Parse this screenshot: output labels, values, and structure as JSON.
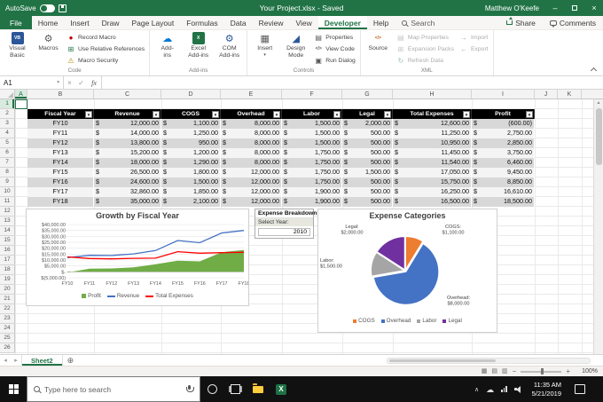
{
  "titlebar": {
    "autosave_label": "AutoSave",
    "title": "Your Project.xlsx - Saved",
    "user": "Matthew O'Keefe"
  },
  "ribbon": {
    "tabs": [
      {
        "label": "File",
        "variant": "file"
      },
      {
        "label": "Home"
      },
      {
        "label": "Insert"
      },
      {
        "label": "Draw"
      },
      {
        "label": "Page Layout"
      },
      {
        "label": "Formulas"
      },
      {
        "label": "Data"
      },
      {
        "label": "Review"
      },
      {
        "label": "View"
      },
      {
        "label": "Developer",
        "active": true
      },
      {
        "label": "Help"
      }
    ],
    "search_label": "Search",
    "share_label": "Share",
    "comments_label": "Comments",
    "groups": [
      {
        "label": "Code",
        "buttons": [
          {
            "label": "Visual Basic",
            "lines": [
              "Visual",
              "Basic"
            ],
            "size": "big",
            "icon": "visual-basic"
          },
          {
            "label": "Macros",
            "size": "big",
            "icon": "macros"
          },
          {
            "label": "Record Macro",
            "size": "small",
            "icon": "record-macro"
          },
          {
            "label": "Use Relative References",
            "size": "small",
            "icon": "relative-references"
          },
          {
            "label": "Macro Security",
            "size": "small",
            "icon": "macro-security"
          }
        ]
      },
      {
        "label": "Add-ins",
        "buttons": [
          {
            "label": "Add-ins",
            "lines": [
              "Add-",
              "ins"
            ],
            "size": "big",
            "icon": "office-add-ins"
          },
          {
            "label": "Excel Add-ins",
            "lines": [
              "Excel",
              "Add-ins"
            ],
            "size": "big",
            "icon": "excel-add-ins"
          },
          {
            "label": "COM Add-ins",
            "lines": [
              "COM",
              "Add-ins"
            ],
            "size": "big",
            "icon": "com-add-ins"
          }
        ]
      },
      {
        "label": "Controls",
        "buttons": [
          {
            "label": "Insert",
            "size": "big",
            "icon": "insert-control",
            "caret": true
          },
          {
            "label": "Design Mode",
            "lines": [
              "Design",
              "Mode"
            ],
            "size": "big",
            "icon": "design-mode"
          },
          {
            "label": "Properties",
            "size": "small",
            "icon": "properties"
          },
          {
            "label": "View Code",
            "size": "small",
            "icon": "view-code"
          },
          {
            "label": "Run Dialog",
            "size": "small",
            "icon": "run-dialog"
          }
        ]
      },
      {
        "label": "XML",
        "buttons": [
          {
            "label": "Source",
            "size": "big",
            "icon": "xml-source"
          },
          {
            "label": "Map Properties",
            "size": "small",
            "icon": "map-properties",
            "disabled": true
          },
          {
            "label": "Expansion Packs",
            "size": "small",
            "icon": "expansion-packs",
            "disabled": true
          },
          {
            "label": "Refresh Data",
            "size": "small",
            "icon": "refresh-data",
            "disabled": true
          },
          {
            "label": "Import",
            "size": "small",
            "icon": "import",
            "disabled": true
          },
          {
            "label": "Export",
            "size": "small",
            "icon": "export",
            "disabled": true
          }
        ]
      }
    ]
  },
  "formula_bar": {
    "name_box": "A1",
    "formula": ""
  },
  "sheet": {
    "columns": [
      "A",
      "B",
      "C",
      "D",
      "E",
      "F",
      "G",
      "H",
      "I",
      "J",
      "K"
    ],
    "rows_visible": 26,
    "selected_cell": "A1",
    "table": {
      "currency": "$",
      "headers": [
        "Fiscal Year",
        "Revenue",
        "COGS",
        "Overhead",
        "Labor",
        "Legal",
        "Total Expenses",
        "Profit"
      ],
      "rows": [
        {
          "year": "FY10",
          "values": [
            "12,000.00",
            "1,100.00",
            "8,000.00",
            "1,500.00",
            "2,000.00",
            "12,600.00",
            "(600.00)"
          ]
        },
        {
          "year": "FY11",
          "values": [
            "14,000.00",
            "1,250.00",
            "8,000.00",
            "1,500.00",
            "500.00",
            "11,250.00",
            "2,750.00"
          ]
        },
        {
          "year": "FY12",
          "values": [
            "13,800.00",
            "950.00",
            "8,000.00",
            "1,500.00",
            "500.00",
            "10,950.00",
            "2,850.00"
          ]
        },
        {
          "year": "FY13",
          "values": [
            "15,200.00",
            "1,200.00",
            "8,000.00",
            "1,750.00",
            "500.00",
            "11,450.00",
            "3,750.00"
          ]
        },
        {
          "year": "FY14",
          "values": [
            "18,000.00",
            "1,290.00",
            "8,000.00",
            "1,750.00",
            "500.00",
            "11,540.00",
            "6,460.00"
          ]
        },
        {
          "year": "FY15",
          "values": [
            "26,500.00",
            "1,800.00",
            "12,000.00",
            "1,750.00",
            "1,500.00",
            "17,050.00",
            "9,450.00"
          ]
        },
        {
          "year": "FY16",
          "values": [
            "24,600.00",
            "1,500.00",
            "12,000.00",
            "1,750.00",
            "500.00",
            "15,750.00",
            "8,850.00"
          ]
        },
        {
          "year": "FY17",
          "values": [
            "32,860.00",
            "1,850.00",
            "12,000.00",
            "1,900.00",
            "500.00",
            "16,250.00",
            "16,610.00"
          ]
        },
        {
          "year": "FY18",
          "values": [
            "35,000.00",
            "2,100.00",
            "12,000.00",
            "1,900.00",
            "500.00",
            "16,500.00",
            "18,500.00"
          ]
        }
      ]
    }
  },
  "slicer": {
    "title": "Expense Breakdown",
    "field_label": "Select Year:",
    "selected": "2010"
  },
  "chart_data": [
    {
      "type": "line",
      "title": "Growth by Fiscal Year",
      "categories": [
        "FY10",
        "FY11",
        "FY12",
        "FY13",
        "FY14",
        "FY15",
        "FY16",
        "FY17",
        "FY18"
      ],
      "series": [
        {
          "name": "Profit",
          "chart": "area",
          "color": "#70AD47",
          "values": [
            -600,
            2750,
            2850,
            3750,
            6460,
            9450,
            8850,
            16610,
            18500
          ]
        },
        {
          "name": "Revenue",
          "chart": "line",
          "color": "#4472C4",
          "values": [
            12000,
            14000,
            13800,
            15200,
            18000,
            26500,
            24600,
            32860,
            35000
          ]
        },
        {
          "name": "Total Expenses",
          "chart": "line",
          "color": "#FF0000",
          "values": [
            12600,
            11250,
            10950,
            11450,
            11540,
            17050,
            15750,
            16250,
            16500
          ]
        }
      ],
      "ylim": [
        -5000,
        40000
      ],
      "ytick_labels_top_down": [
        "$40,000.00",
        "$35,000.00",
        "$30,000.00",
        "$25,000.00",
        "$20,000.00",
        "$15,000.00",
        "$10,000.00",
        "$5,000.00",
        "$-",
        "$(5,000.00)"
      ],
      "grid": true,
      "legend_position": "bottom"
    },
    {
      "type": "pie",
      "title": "Expense Categories",
      "series": [
        {
          "name": "COGS",
          "value": 1100,
          "value_label": "$1,100.00",
          "color": "#ED7D31"
        },
        {
          "name": "Overhead",
          "value": 8000,
          "value_label": "$8,000.00",
          "color": "#4472C4"
        },
        {
          "name": "Labor",
          "value": 1500,
          "value_label": "$1,500.00",
          "color": "#A5A5A5"
        },
        {
          "name": "Legal",
          "value": 2000,
          "value_label": "$2,000.00",
          "color": "#7030A0"
        }
      ],
      "legend": [
        "COGS",
        "Overhead",
        "Labor",
        "Legal"
      ],
      "legend_position": "bottom"
    }
  ],
  "sheet_tabs": [
    "Sheet2"
  ],
  "status_bar": {
    "zoom": "100%"
  },
  "taskbar": {
    "search_placeholder": "Type here to search",
    "time": "11:35 AM",
    "date": "5/21/2019"
  }
}
